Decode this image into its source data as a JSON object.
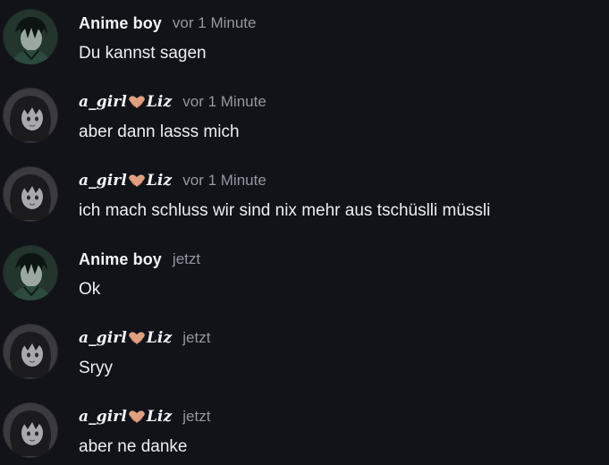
{
  "users": {
    "anime": {
      "name": "Anime boy",
      "avatar_icon": "anime-boy-avatar"
    },
    "liz": {
      "name_prefix": "a_girl",
      "name_suffix": "Liz",
      "heart_icon": "hands-heart-icon",
      "avatar_icon": "anime-girl-avatar"
    }
  },
  "messages": [
    {
      "author": "Anime boy",
      "time": "vor 1 Minute",
      "text": "Du kannst sagen"
    },
    {
      "author_prefix": "a_girl",
      "author_suffix": "Liz",
      "time": "vor 1 Minute",
      "text": "aber dann lasss mich"
    },
    {
      "author_prefix": "a_girl",
      "author_suffix": "Liz",
      "time": "vor 1 Minute",
      "text": "ich mach schluss wir sind nix mehr aus tschüslli müssli"
    },
    {
      "author": "Anime boy",
      "time": "jetzt",
      "text": "Ok"
    },
    {
      "author_prefix": "a_girl",
      "author_suffix": "Liz",
      "time": "jetzt",
      "text": "Sryy"
    },
    {
      "author_prefix": "a_girl",
      "author_suffix": "Liz",
      "time": "jetzt",
      "text": "aber ne danke"
    }
  ],
  "colors": {
    "background": "#121318",
    "name": "#f2f3f5",
    "timestamp": "#9497a0",
    "message_text": "#eceef1",
    "heart": "#e0a080"
  }
}
